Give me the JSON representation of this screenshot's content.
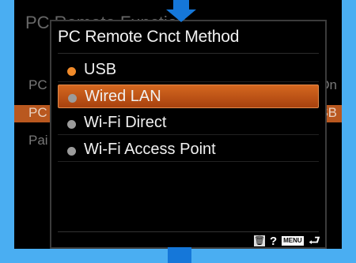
{
  "background_screen": {
    "title": "PC Remote Function",
    "rows": [
      {
        "left": "PC",
        "right": "On"
      },
      {
        "left": "PC",
        "right": "SB"
      },
      {
        "left": "Pai",
        "right": ""
      }
    ]
  },
  "dialog": {
    "title": "PC Remote Cnct Method",
    "options": [
      {
        "label": "USB",
        "selected": true
      },
      {
        "label": "Wired LAN",
        "focused": true
      },
      {
        "label": "Wi-Fi Direct"
      },
      {
        "label": "Wi-Fi Access Point"
      }
    ]
  },
  "footer": {
    "trash_icon": "trash-icon",
    "help_text": "?",
    "menu_icon_text": "MENU",
    "back_icon": "back-arrow-icon"
  },
  "colors": {
    "screen_background": "#000000",
    "focus_orange": "#c9561b",
    "selected_dot": "#f08a2a",
    "page_background": "#4aaef2",
    "arrow_blue": "#1577d9"
  }
}
